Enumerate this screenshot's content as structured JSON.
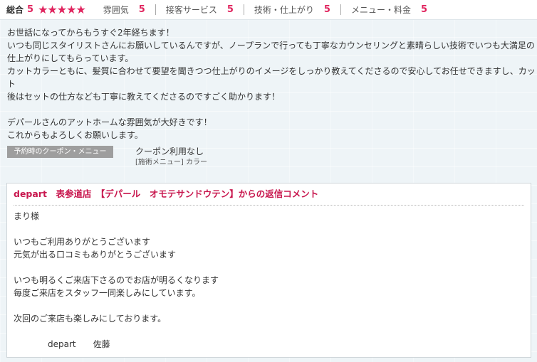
{
  "ratings": {
    "overall_label": "総合",
    "overall_score": "5",
    "stars": "★★★★★",
    "categories": [
      {
        "label": "雰囲気",
        "score": "5"
      },
      {
        "label": "接客サービス",
        "score": "5"
      },
      {
        "label": "技術・仕上がり",
        "score": "5"
      },
      {
        "label": "メニュー・料金",
        "score": "5"
      }
    ]
  },
  "review": {
    "text": "お世話になってからもうすぐ2年経ちます！\nいつも同じスタイリストさんにお願いしているんですが、ノープランで行っても丁寧なカウンセリングと素晴らしい技術でいつも大満足の\n仕上がりにしてもらっています。\nカットカラーともに、髪質に合わせて要望を聞きつつ仕上がりのイメージをしっかり教えてくださるので安心してお任せできますし、カット\n後はセットの仕方なども丁寧に教えてくださるのですごく助かります！\n\nデパールさんのアットホームな雰囲気が大好きです！\nこれからもよろしくお願いします。"
  },
  "coupon": {
    "tag_label": "予約時のクーポン・メニュー",
    "text": "クーポン利用なし",
    "sub": "[施術メニュー] カラー"
  },
  "reply": {
    "title": "depart　表参道店　【デパール　オモテサンドウテン】からの返信コメント",
    "body": "まり様\n\nいつもご利用ありがとうございます\n元気が出る口コミもありがとうございます\n\nいつも明るくご来店下さるのでお店が明るくなります\n毎度ご来店をスタッフ一同楽しみにしています。\n\n次回のご来店も楽しみにしております。\n\n　　　　depart　　佐藤"
  },
  "colors": {
    "accent": "#e0245e",
    "reply_title": "#c8174e",
    "tag_bg": "#9e9e9e",
    "page_bg": "#eef4f7"
  }
}
